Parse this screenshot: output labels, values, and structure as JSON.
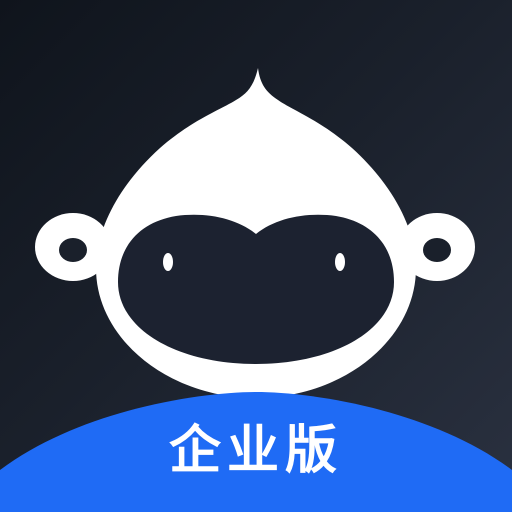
{
  "app_icon": {
    "badge_text": "企业版",
    "mascot_icon": "monkey-face-icon",
    "colors": {
      "background_dark": "#0f141c",
      "background_light": "#2a3140",
      "mascot": "#ffffff",
      "badge": "#1f6bf5",
      "face": "#1c2230"
    }
  }
}
